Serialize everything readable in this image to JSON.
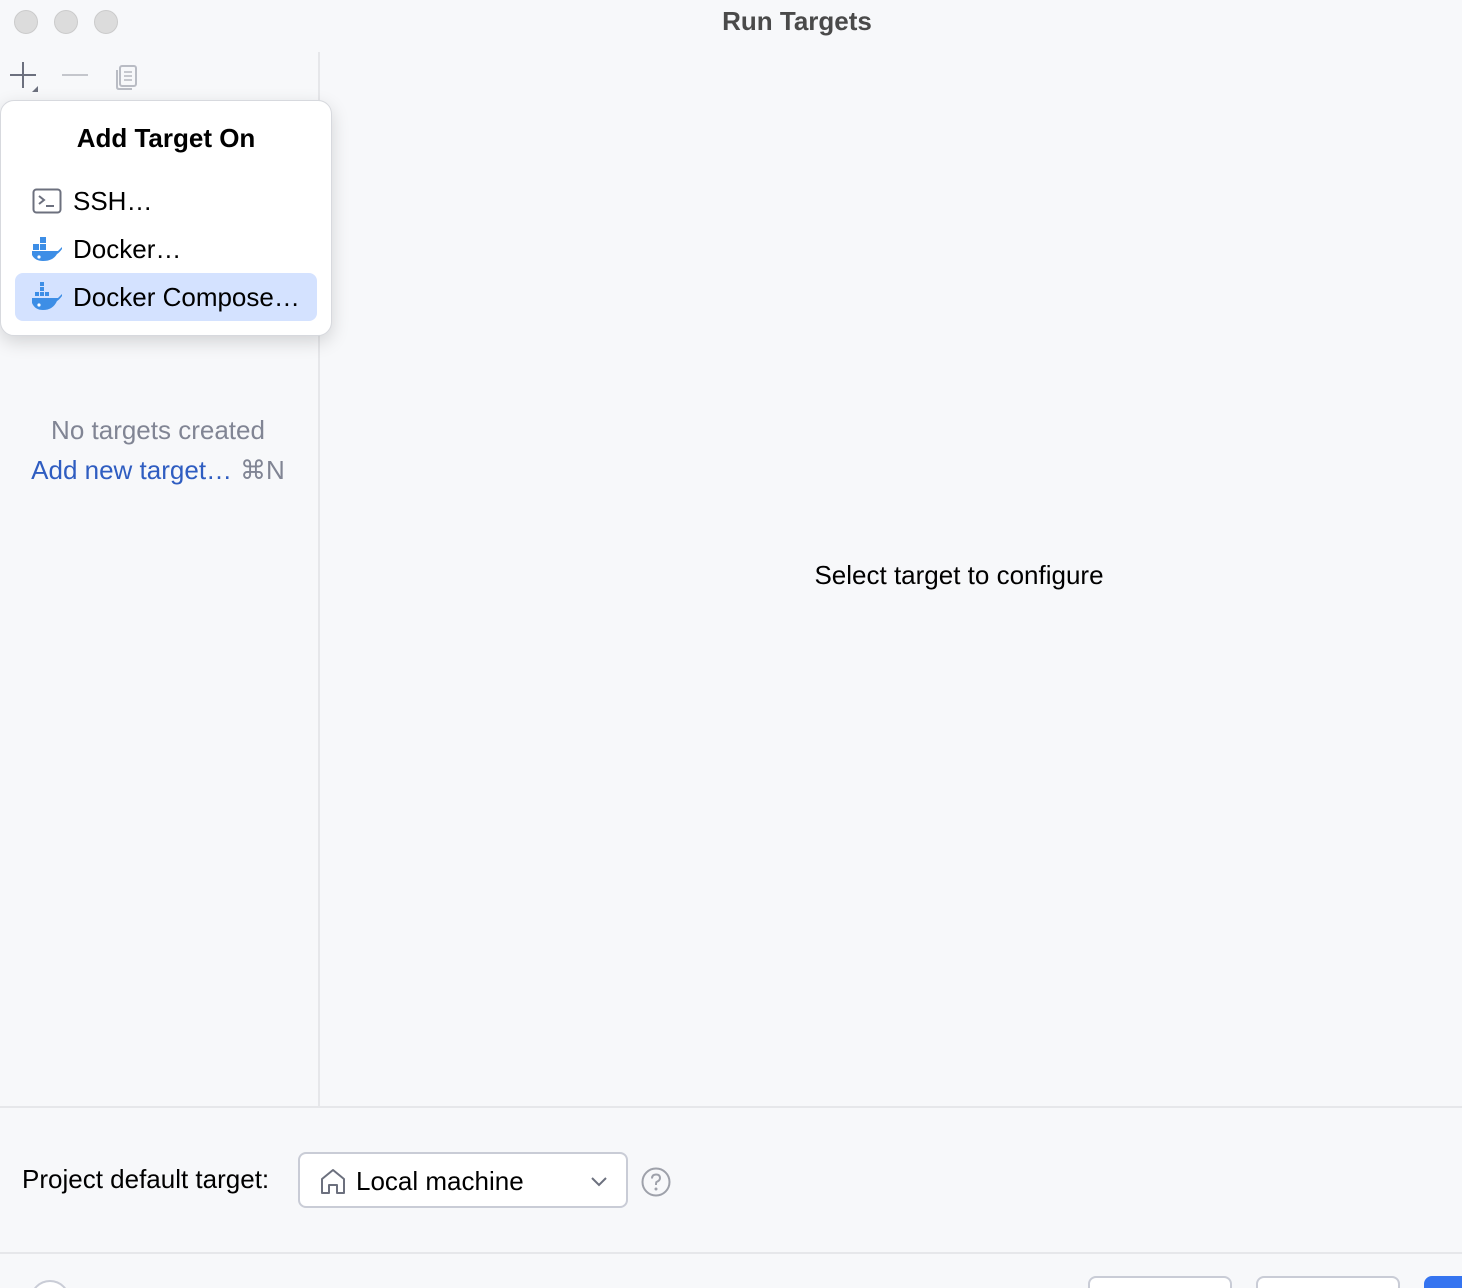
{
  "window": {
    "title": "Run Targets"
  },
  "toolbar": {
    "add_icon": "plus-icon",
    "remove_icon": "minus-icon",
    "copy_icon": "copy-icon"
  },
  "popup": {
    "title": "Add Target On",
    "items": [
      {
        "label": "SSH…",
        "icon": "terminal-icon",
        "selected": false
      },
      {
        "label": "Docker…",
        "icon": "docker-icon",
        "selected": false
      },
      {
        "label": "Docker Compose…",
        "icon": "docker-icon",
        "selected": true
      }
    ]
  },
  "left_panel": {
    "empty_title": "No targets created",
    "add_link": "Add new target…",
    "shortcut": "⌘N"
  },
  "right_panel": {
    "hint": "Select target to configure"
  },
  "bottom": {
    "label": "Project default target:",
    "dropdown_value": "Local machine",
    "dropdown_icon": "home-icon"
  },
  "colors": {
    "background": "#f7f8fa",
    "link": "#2f5dc1",
    "selected_item": "#d4e2ff",
    "docker_blue": "#3d8ee6",
    "primary_button": "#3574f0"
  }
}
